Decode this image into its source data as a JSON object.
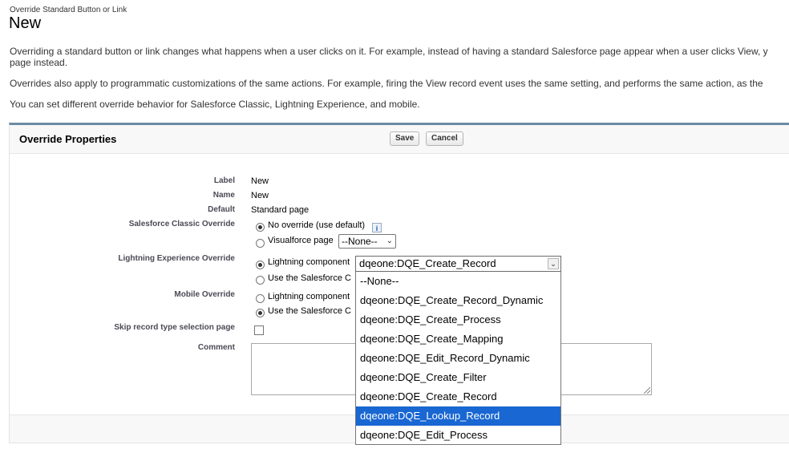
{
  "breadcrumb": "Override Standard Button or Link",
  "title": "New",
  "paragraphs": [
    "Overriding a standard button or link changes what happens when a user clicks on it. For example, instead of having a standard Salesforce page appear when a user clicks View, y",
    "page instead.",
    "Overrides also apply to programmatic customizations of the same actions. For example, firing the View record event uses the same setting, and performs the same action, as the",
    "You can set different override behavior for Salesforce Classic, Lightning Experience, and mobile."
  ],
  "panel": {
    "title": "Override Properties",
    "save_label": "Save",
    "cancel_label": "Cancel"
  },
  "fields": {
    "label_label": "Label",
    "label_value": "New",
    "name_label": "Name",
    "name_value": "New",
    "default_label": "Default",
    "default_value": "Standard page",
    "classic_label": "Salesforce Classic Override",
    "classic_opt1": "No override (use default)",
    "classic_opt2": "Visualforce page",
    "classic_select_value": "--None--",
    "lightning_label": "Lightning Experience Override",
    "lightning_opt1": "Lightning component",
    "lightning_opt2": "Use the Salesforce C",
    "mobile_label": "Mobile Override",
    "mobile_opt1": "Lightning component",
    "mobile_opt2": "Use the Salesforce C",
    "skip_label": "Skip record type selection page",
    "comment_label": "Comment"
  },
  "dropdown": {
    "selected_value": "dqeone:DQE_Create_Record",
    "options": [
      "--None--",
      "dqeone:DQE_Create_Record_Dynamic",
      "dqeone:DQE_Create_Process",
      "dqeone:DQE_Create_Mapping",
      "dqeone:DQE_Edit_Record_Dynamic",
      "dqeone:DQE_Create_Filter",
      "dqeone:DQE_Create_Record",
      "dqeone:DQE_Lookup_Record",
      "dqeone:DQE_Edit_Process"
    ],
    "highlighted_option": "dqeone:DQE_Lookup_Record"
  },
  "icons": {
    "info": "info-icon",
    "chevron": "chevron-down-icon"
  },
  "colors": {
    "panel_border": "#6a8aa3",
    "highlight": "#1967d2"
  }
}
